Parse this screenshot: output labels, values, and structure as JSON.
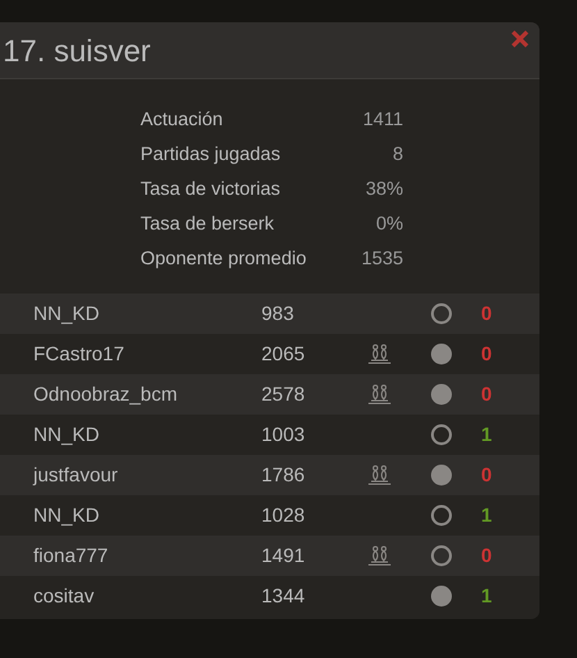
{
  "title": "17. suisver",
  "stats": [
    {
      "label": "Actuación",
      "value": "1411"
    },
    {
      "label": "Partidas jugadas",
      "value": "8"
    },
    {
      "label": "Tasa de victorias",
      "value": "38%"
    },
    {
      "label": "Tasa de berserk",
      "value": "0%"
    },
    {
      "label": "Oponente promedio",
      "value": "1535"
    }
  ],
  "games": [
    {
      "opponent": "NN_KD",
      "rating": "983",
      "berserk": false,
      "filled": false,
      "score": "0",
      "win": false
    },
    {
      "opponent": "FCastro17",
      "rating": "2065",
      "berserk": true,
      "filled": true,
      "score": "0",
      "win": false
    },
    {
      "opponent": "Odnoobraz_bcm",
      "rating": "2578",
      "berserk": true,
      "filled": true,
      "score": "0",
      "win": false
    },
    {
      "opponent": "NN_KD",
      "rating": "1003",
      "berserk": false,
      "filled": false,
      "score": "1",
      "win": true
    },
    {
      "opponent": "justfavour",
      "rating": "1786",
      "berserk": true,
      "filled": true,
      "score": "0",
      "win": false
    },
    {
      "opponent": "NN_KD",
      "rating": "1028",
      "berserk": false,
      "filled": false,
      "score": "1",
      "win": true
    },
    {
      "opponent": "fiona777",
      "rating": "1491",
      "berserk": true,
      "filled": false,
      "score": "0",
      "win": false
    },
    {
      "opponent": "cositav",
      "rating": "1344",
      "berserk": false,
      "filled": true,
      "score": "1",
      "win": true
    }
  ]
}
